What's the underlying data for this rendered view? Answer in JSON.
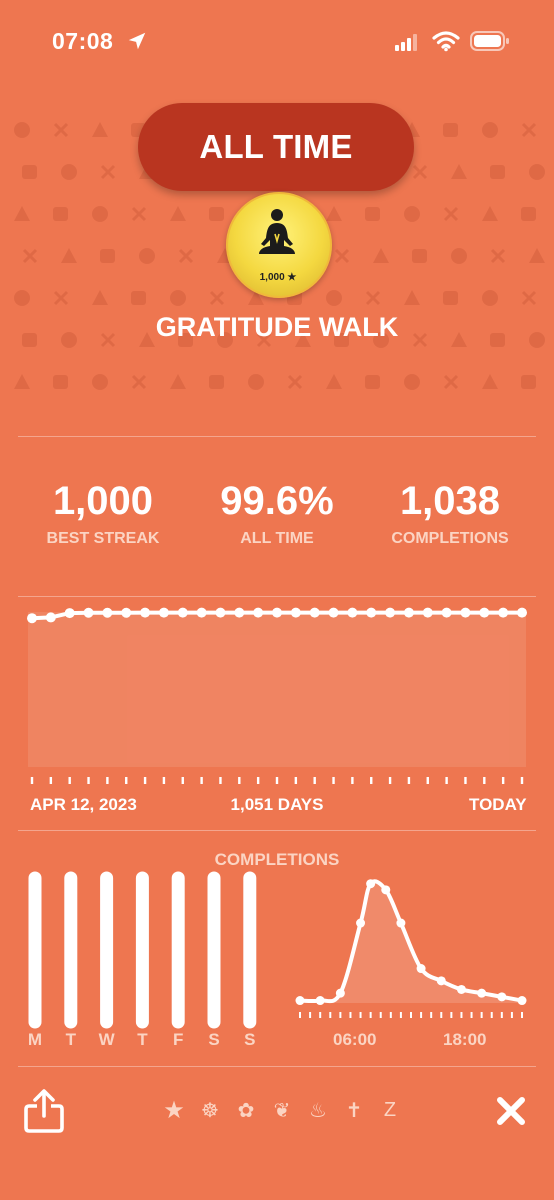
{
  "status_bar": {
    "time": "07:08"
  },
  "header": {
    "period_label": "ALL TIME"
  },
  "badge": {
    "count": "1,000 ★",
    "icon": "meditation-person-icon"
  },
  "habit": {
    "title": "GRATITUDE WALK"
  },
  "stats": [
    {
      "value": "1,000",
      "label": "BEST STREAK"
    },
    {
      "value": "99.6%",
      "label": "ALL TIME"
    },
    {
      "value": "1,038",
      "label": "COMPLETIONS"
    }
  ],
  "progress_chart": {
    "start_label": "APR 12, 2023",
    "span_label": "1,051 DAYS",
    "end_label": "TODAY"
  },
  "completions_section": {
    "title": "COMPLETIONS"
  },
  "chart_data": [
    {
      "type": "line",
      "x": [
        "APR 12, 2023",
        "",
        "",
        "",
        "",
        "",
        "",
        "",
        "",
        "",
        "",
        "",
        "",
        "",
        "",
        "",
        "",
        "",
        "",
        "",
        "",
        "",
        "",
        "",
        "",
        "",
        "TODAY"
      ],
      "values": [
        96.0,
        96.5,
        99.3,
        99.5,
        99.5,
        99.5,
        99.6,
        99.6,
        99.6,
        99.6,
        99.6,
        99.6,
        99.6,
        99.6,
        99.6,
        99.6,
        99.6,
        99.6,
        99.6,
        99.6,
        99.6,
        99.6,
        99.6,
        99.6,
        99.6,
        99.6,
        99.6
      ],
      "ylim": [
        0,
        100
      ],
      "grid": false
    },
    {
      "type": "bar",
      "categories": [
        "M",
        "T",
        "W",
        "T",
        "F",
        "S",
        "S"
      ],
      "values": [
        1,
        1,
        1,
        1,
        1,
        1,
        1
      ],
      "ylim": [
        0,
        1
      ]
    },
    {
      "type": "area",
      "x_tick_labels": [
        "06:00",
        "18:00"
      ],
      "x": [
        0,
        2,
        4,
        6,
        7,
        8.5,
        10,
        12,
        14,
        16,
        18,
        20,
        22
      ],
      "values": [
        0.02,
        0.02,
        0.08,
        0.65,
        0.97,
        0.92,
        0.65,
        0.28,
        0.18,
        0.11,
        0.08,
        0.05,
        0.02
      ],
      "xlim": [
        0,
        22
      ],
      "ylim": [
        0,
        1
      ]
    }
  ],
  "bottom_bar": {
    "share": "share-icon",
    "close": "close-icon",
    "tabs": [
      "★",
      "☸",
      "✿",
      "❦",
      "♨",
      "✝",
      "Z"
    ]
  },
  "colors": {
    "background": "#ee7650",
    "pill": "#b93520",
    "badge_gold": "#f4d840",
    "muted_text": "#fbd4c3"
  }
}
